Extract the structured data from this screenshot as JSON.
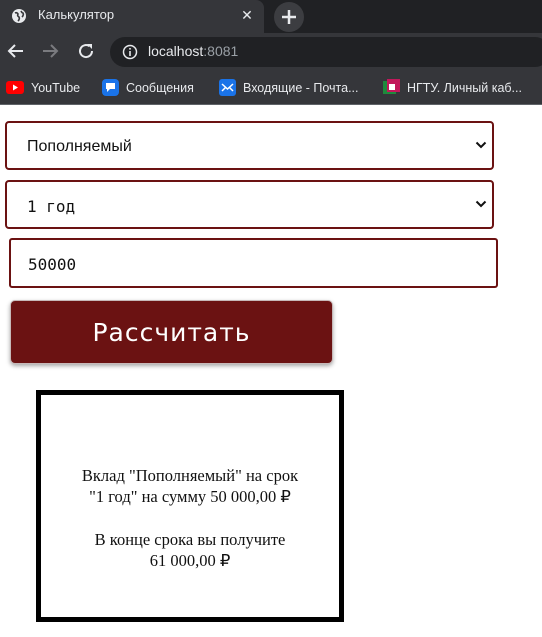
{
  "browser": {
    "tab_title": "Калькулятор",
    "url_host": "localhost",
    "url_port": ":8081",
    "bookmarks": [
      {
        "label": "YouTube",
        "icon": "youtube-icon"
      },
      {
        "label": "Сообщения",
        "icon": "messages-icon"
      },
      {
        "label": "Входящие - Почта...",
        "icon": "mail-icon"
      },
      {
        "label": "НГТУ. Личный каб...",
        "icon": "ngtu-icon"
      }
    ]
  },
  "form": {
    "deposit_type": "Пополняемый",
    "term": "1 год",
    "amount": "50000",
    "calculate_label": "Рассчитать"
  },
  "result": {
    "line1": "Вклад \"Пополняемый\" на срок",
    "line2": "\"1 год\" на сумму 50 000,00 ₽",
    "line3": "В конце срока вы получите",
    "line4": "61 000,00 ₽"
  },
  "colors": {
    "accent": "#6b1212",
    "chrome_dark": "#202124",
    "chrome": "#35363a"
  }
}
